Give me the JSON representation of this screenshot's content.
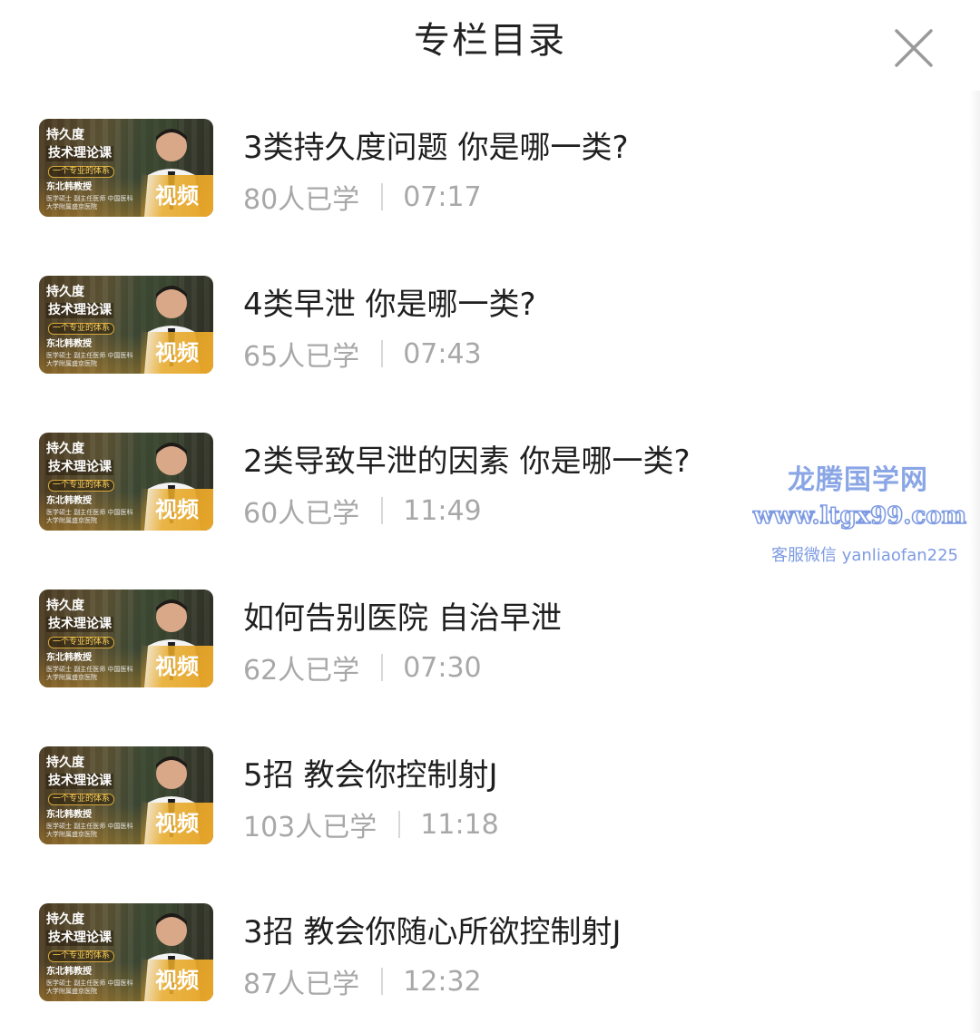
{
  "header": {
    "title": "专栏目录"
  },
  "thumbnail": {
    "line1": "持久度",
    "line2": "技术理论课",
    "line3": "一个专业的体系",
    "line4": "东北韩教授",
    "line5": "医学硕士 副主任医师 中国医科大学附属盛京医院",
    "badge": "视频"
  },
  "items": [
    {
      "title": "3类持久度问题 你是哪一类?",
      "learners": "80人已学",
      "duration": "07:17"
    },
    {
      "title": "4类早泄 你是哪一类?",
      "learners": "65人已学",
      "duration": "07:43"
    },
    {
      "title": "2类导致早泄的因素 你是哪一类?",
      "learners": "60人已学",
      "duration": "11:49"
    },
    {
      "title": "如何告别医院 自治早泄",
      "learners": "62人已学",
      "duration": "07:30"
    },
    {
      "title": "5招 教会你控制射J",
      "learners": "103人已学",
      "duration": "11:18"
    },
    {
      "title": "3招 教会你随心所欲控制射J",
      "learners": "87人已学",
      "duration": "12:32"
    }
  ],
  "watermark": {
    "name": "龙腾国学网",
    "url": "www.ltgx99.com",
    "contact": "客服微信 yanliaofan225"
  },
  "colors": {
    "title_text": "#1f1f1f",
    "meta_text": "#a8a8a8",
    "badge": "#e7a52a",
    "watermark": "#7e9be2"
  }
}
